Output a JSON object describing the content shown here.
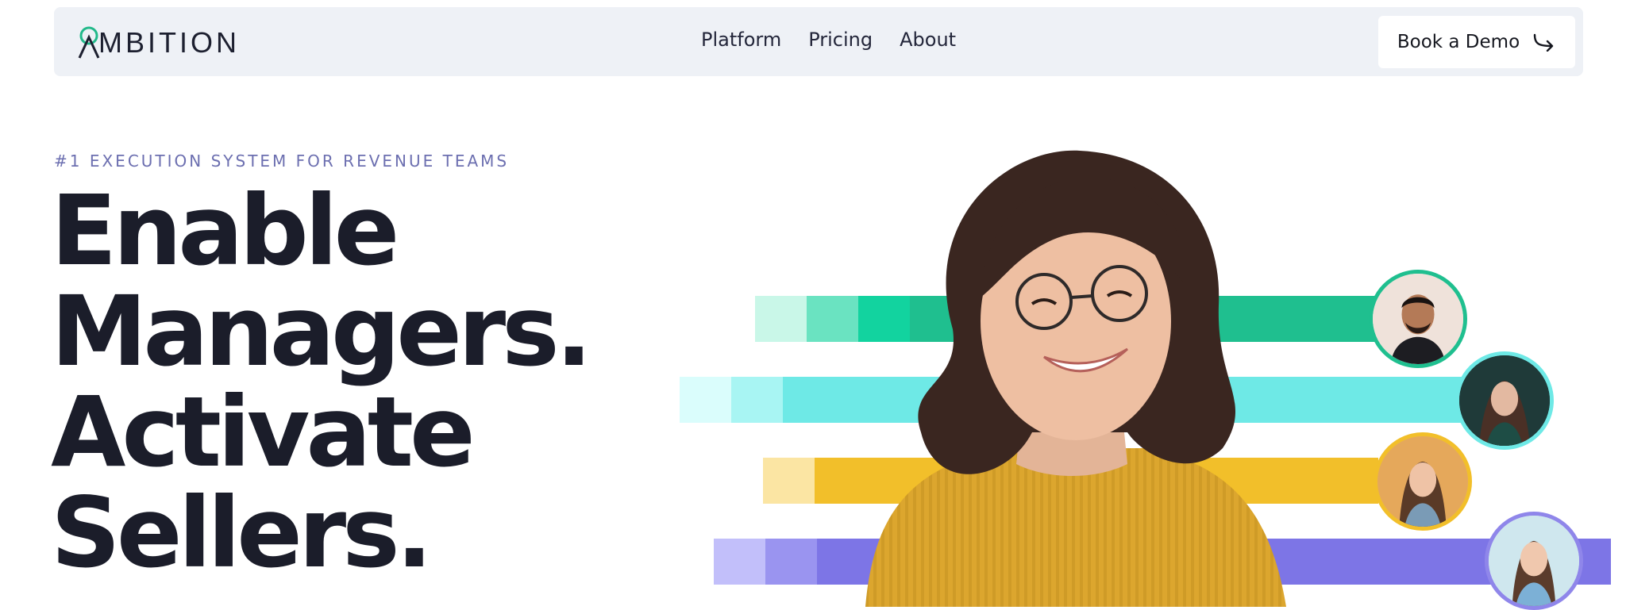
{
  "nav": {
    "logo_text": "MBITION",
    "links": [
      "Platform",
      "Pricing",
      "About"
    ],
    "cta_label": "Book a Demo"
  },
  "hero": {
    "eyebrow": "#1 EXECUTION SYSTEM FOR REVENUE TEAMS",
    "headline": [
      "Enable",
      "Managers.",
      "Activate",
      "Sellers."
    ]
  },
  "colors": {
    "accent": "#6c6fb0",
    "green": "#1fbf8f",
    "cyan": "#6ee9e6",
    "yellow": "#f2bf2a",
    "violet": "#7d75e6",
    "nav_bg": "#eef1f6"
  },
  "icons": {
    "logo": "ambition-logo-mark",
    "cta": "curved-arrow-icon"
  }
}
